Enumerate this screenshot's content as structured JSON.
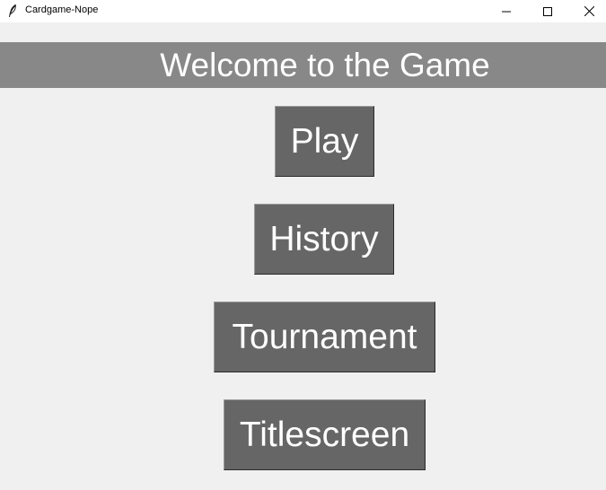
{
  "window": {
    "title": "Cardgame-Nope",
    "icon": "feather-icon",
    "controls": [
      "minimize-icon",
      "maximize-icon",
      "close-icon"
    ]
  },
  "banner": {
    "text": "Welcome to the Game"
  },
  "menu": {
    "play": "Play",
    "history": "History",
    "tournament": "Tournament",
    "titlescreen": "Titlescreen"
  },
  "colors": {
    "background": "#f0f0f0",
    "banner": "#888888",
    "button": "#666666",
    "text": "#ffffff"
  }
}
